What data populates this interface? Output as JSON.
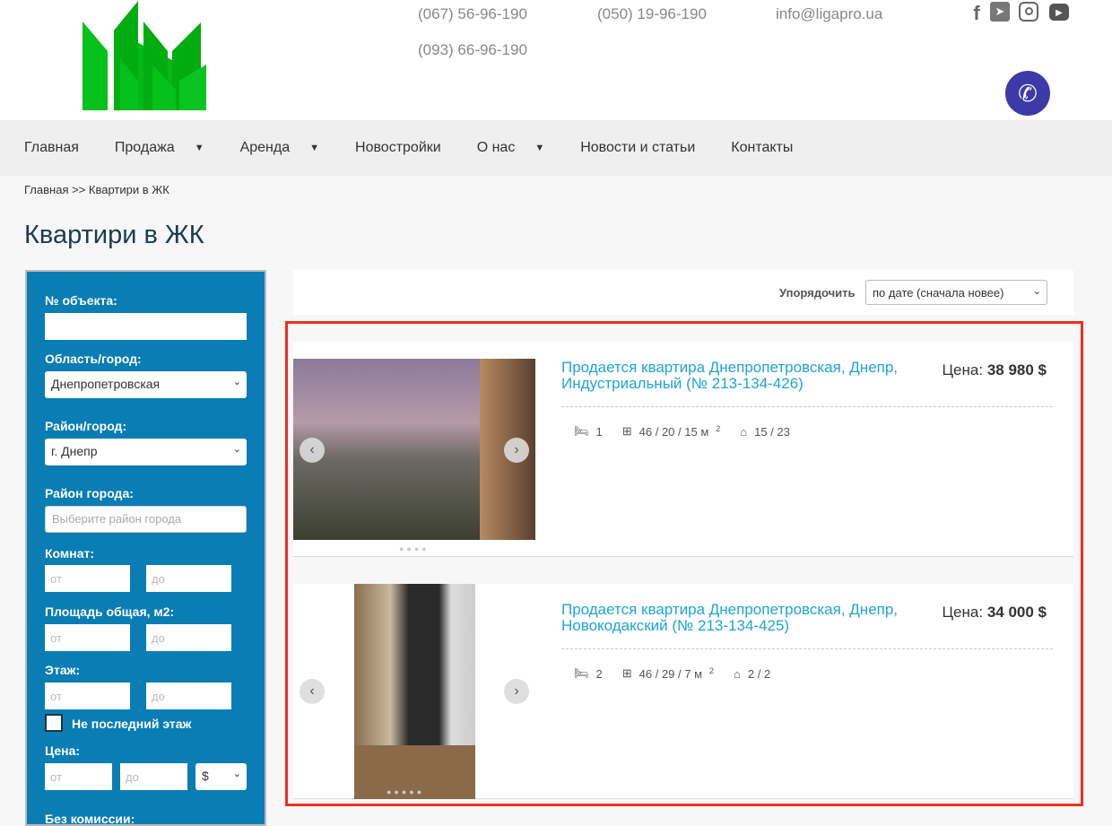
{
  "header": {
    "phones": [
      "(067) 56-96-190",
      "(050) 19-96-190",
      "(093) 66-96-190"
    ],
    "email": "info@ligapro.ua",
    "social": [
      "facebook-icon",
      "telegram-icon",
      "instagram-icon",
      "youtube-icon"
    ]
  },
  "nav": [
    {
      "label": "Главная",
      "dropdown": false
    },
    {
      "label": "Продажа",
      "dropdown": true
    },
    {
      "label": "Аренда",
      "dropdown": true
    },
    {
      "label": "Новостройки",
      "dropdown": false
    },
    {
      "label": "О нас",
      "dropdown": true
    },
    {
      "label": "Новости и статьи",
      "dropdown": false
    },
    {
      "label": "Контакты",
      "dropdown": false
    }
  ],
  "breadcrumb": {
    "home": "Главная",
    "sep": ">>",
    "current": "Квартири в ЖК"
  },
  "page_title": "Квартири в ЖК",
  "filters": {
    "object_no": "№ объекта:",
    "region": "Область/город:",
    "region_value": "Днепропетровская",
    "district": "Район/город:",
    "district_value": "г. Днепр",
    "city_district": "Район города:",
    "city_district_placeholder": "Выберите район города",
    "rooms": "Комнат:",
    "area": "Площадь общая, м2:",
    "floor": "Этаж:",
    "not_last": "Не последний этаж",
    "price": "Цена:",
    "currency": "$",
    "from": "от",
    "to": "до",
    "no_commission": "Без комиссии:"
  },
  "sort": {
    "label": "Упорядочить",
    "value": "по дате (сначала новее)"
  },
  "listings": [
    {
      "title": "Продается квартира Днепропетровская, Днепр, Индустриальный  (№ 213-134-426)",
      "price_label": "Цена:",
      "price": "38 980 $",
      "rooms": "1",
      "area": "46 / 20 / 15 м",
      "floor": "15 / 23"
    },
    {
      "title": "Продается квартира Днепропетровская, Днепр, Новокодакский  (№ 213-134-425)",
      "price_label": "Цена:",
      "price": "34 000 $",
      "rooms": "2",
      "area": "46 / 29 / 7 м",
      "floor": "2 / 2"
    }
  ],
  "area_sup": "2"
}
